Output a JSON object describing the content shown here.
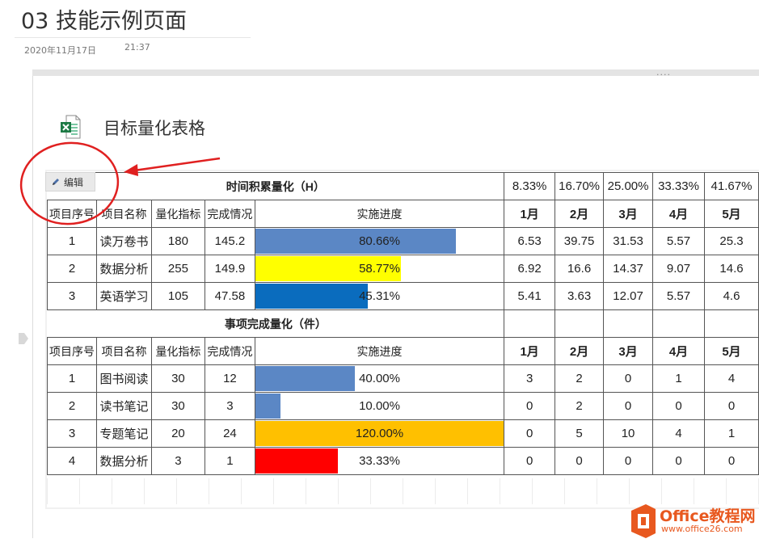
{
  "page": {
    "title": "03 技能示例页面",
    "date": "2020年11月17日",
    "time": "21:37"
  },
  "embed": {
    "title": "目标量化表格",
    "dots": "....",
    "edit_label": "编辑",
    "icon": "excel-icon"
  },
  "section1": {
    "title": "时间积累量化（H）",
    "month_percents": [
      "8.33%",
      "16.70%",
      "25.00%",
      "33.33%",
      "41.67%"
    ],
    "headers": [
      "项目序号",
      "项目名称",
      "量化指标",
      "完成情况",
      "实施进度"
    ],
    "months": [
      "1月",
      "2月",
      "3月",
      "4月",
      "5月"
    ],
    "rows": [
      {
        "no": "1",
        "name": "读万卷书",
        "target": "180",
        "done": "145.2",
        "progress": "80.66%",
        "fraction": 0.8066,
        "color": "#5b87c5",
        "months": [
          "6.53",
          "39.75",
          "31.53",
          "5.57",
          "25.3"
        ]
      },
      {
        "no": "2",
        "name": "数据分析",
        "target": "255",
        "done": "149.9",
        "progress": "58.77%",
        "fraction": 0.5877,
        "color": "#ffff00",
        "months": [
          "6.92",
          "16.6",
          "14.37",
          "9.07",
          "14.6"
        ]
      },
      {
        "no": "3",
        "name": "英语学习",
        "target": "105",
        "done": "47.58",
        "progress": "45.31%",
        "fraction": 0.4531,
        "color": "#0a6cbe",
        "months": [
          "5.41",
          "3.63",
          "12.07",
          "5.57",
          "4.6"
        ]
      }
    ]
  },
  "section2": {
    "title": "事项完成量化（件）",
    "headers": [
      "项目序号",
      "项目名称",
      "量化指标",
      "完成情况",
      "实施进度"
    ],
    "months": [
      "1月",
      "2月",
      "3月",
      "4月",
      "5月"
    ],
    "rows": [
      {
        "no": "1",
        "name": "图书阅读",
        "target": "30",
        "done": "12",
        "progress": "40.00%",
        "fraction": 0.4,
        "color": "#5b87c5",
        "months": [
          "3",
          "2",
          "0",
          "1",
          "4"
        ]
      },
      {
        "no": "2",
        "name": "读书笔记",
        "target": "30",
        "done": "3",
        "progress": "10.00%",
        "fraction": 0.1,
        "color": "#5b87c5",
        "months": [
          "0",
          "2",
          "0",
          "0",
          "0"
        ]
      },
      {
        "no": "3",
        "name": "专题笔记",
        "target": "20",
        "done": "24",
        "progress": "120.00%",
        "fraction": 1.2,
        "color": "#ffc000",
        "months": [
          "0",
          "5",
          "10",
          "4",
          "1"
        ]
      },
      {
        "no": "4",
        "name": "数据分析",
        "target": "3",
        "done": "1",
        "progress": "33.33%",
        "fraction": 0.3333,
        "color": "#ff0000",
        "months": [
          "0",
          "0",
          "0",
          "0",
          "0"
        ]
      }
    ]
  },
  "annotation": {
    "color": "#e02020"
  },
  "watermark": {
    "name": "Office教程网",
    "url": "www.office26.com",
    "icon": "office-logo-icon",
    "color": "#e8581f"
  }
}
